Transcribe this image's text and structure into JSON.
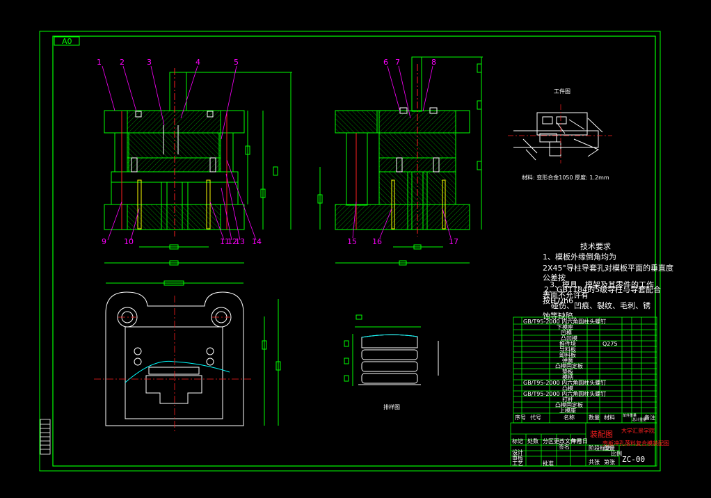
{
  "sheet": {
    "size_label": "A0",
    "drawing_no": "ZC-00",
    "title_mark": "装配图",
    "school": "大学汇景学院",
    "subtitle": "壳板冲孔落料复合模装配图"
  },
  "callouts": {
    "front": [
      "1",
      "2",
      "3",
      "4",
      "5"
    ],
    "bottom_left": [
      "9",
      "10",
      "11",
      "12",
      "13",
      "14"
    ],
    "side_top": [
      "6",
      "7",
      "8"
    ],
    "side_bottom": [
      "15",
      "16",
      "17"
    ]
  },
  "part_drawing": {
    "title": "工件图",
    "material_note": "材料: 变形合金1050  厚度: 1.2mm"
  },
  "strip_layout": {
    "title": "排样图"
  },
  "tech": {
    "heading": "技术要求",
    "lines": [
      "1、模板外缘倒角均为",
      "2X45°导柱导套孔对模板平面的垂直度",
      "公差按",
      "3、模具、模架及其零件的工作",
      "表面不允许有",
      "碰伤、凹痕、裂纹、毛刺、锈",
      "蚀等缺陷。",
      "2、GB1184的5级导柱与导套配合",
      "按H7/h6"
    ]
  },
  "bom": {
    "headers": [
      "序号",
      "代号",
      "名称",
      "数量",
      "材料",
      "单件重量",
      "总计重量",
      "备注"
    ],
    "row_texts": [
      "GB/T95-2000 内六角圆柱头螺钉",
      "下模座",
      "凹模",
      "凸凹模",
      "推件块",
      "导料板",
      "卸料板",
      "弹簧",
      "凸模固定板",
      "垫板",
      "模柄",
      "GB/T95-2000 内六角圆柱头螺钉",
      "凸模",
      "GB/T95-2000 内六角圆柱头螺钉",
      "打杆",
      "凸模固定板",
      "上模座"
    ],
    "material_hint": "Q275"
  },
  "title_block": {
    "rows": [
      "标记",
      "处数",
      "分区",
      "更改文件号",
      "签名",
      "年月日",
      "设计",
      "审核",
      "工艺",
      "批准",
      "阶段标记",
      "重量",
      "比例",
      "共张",
      "第张"
    ]
  }
}
